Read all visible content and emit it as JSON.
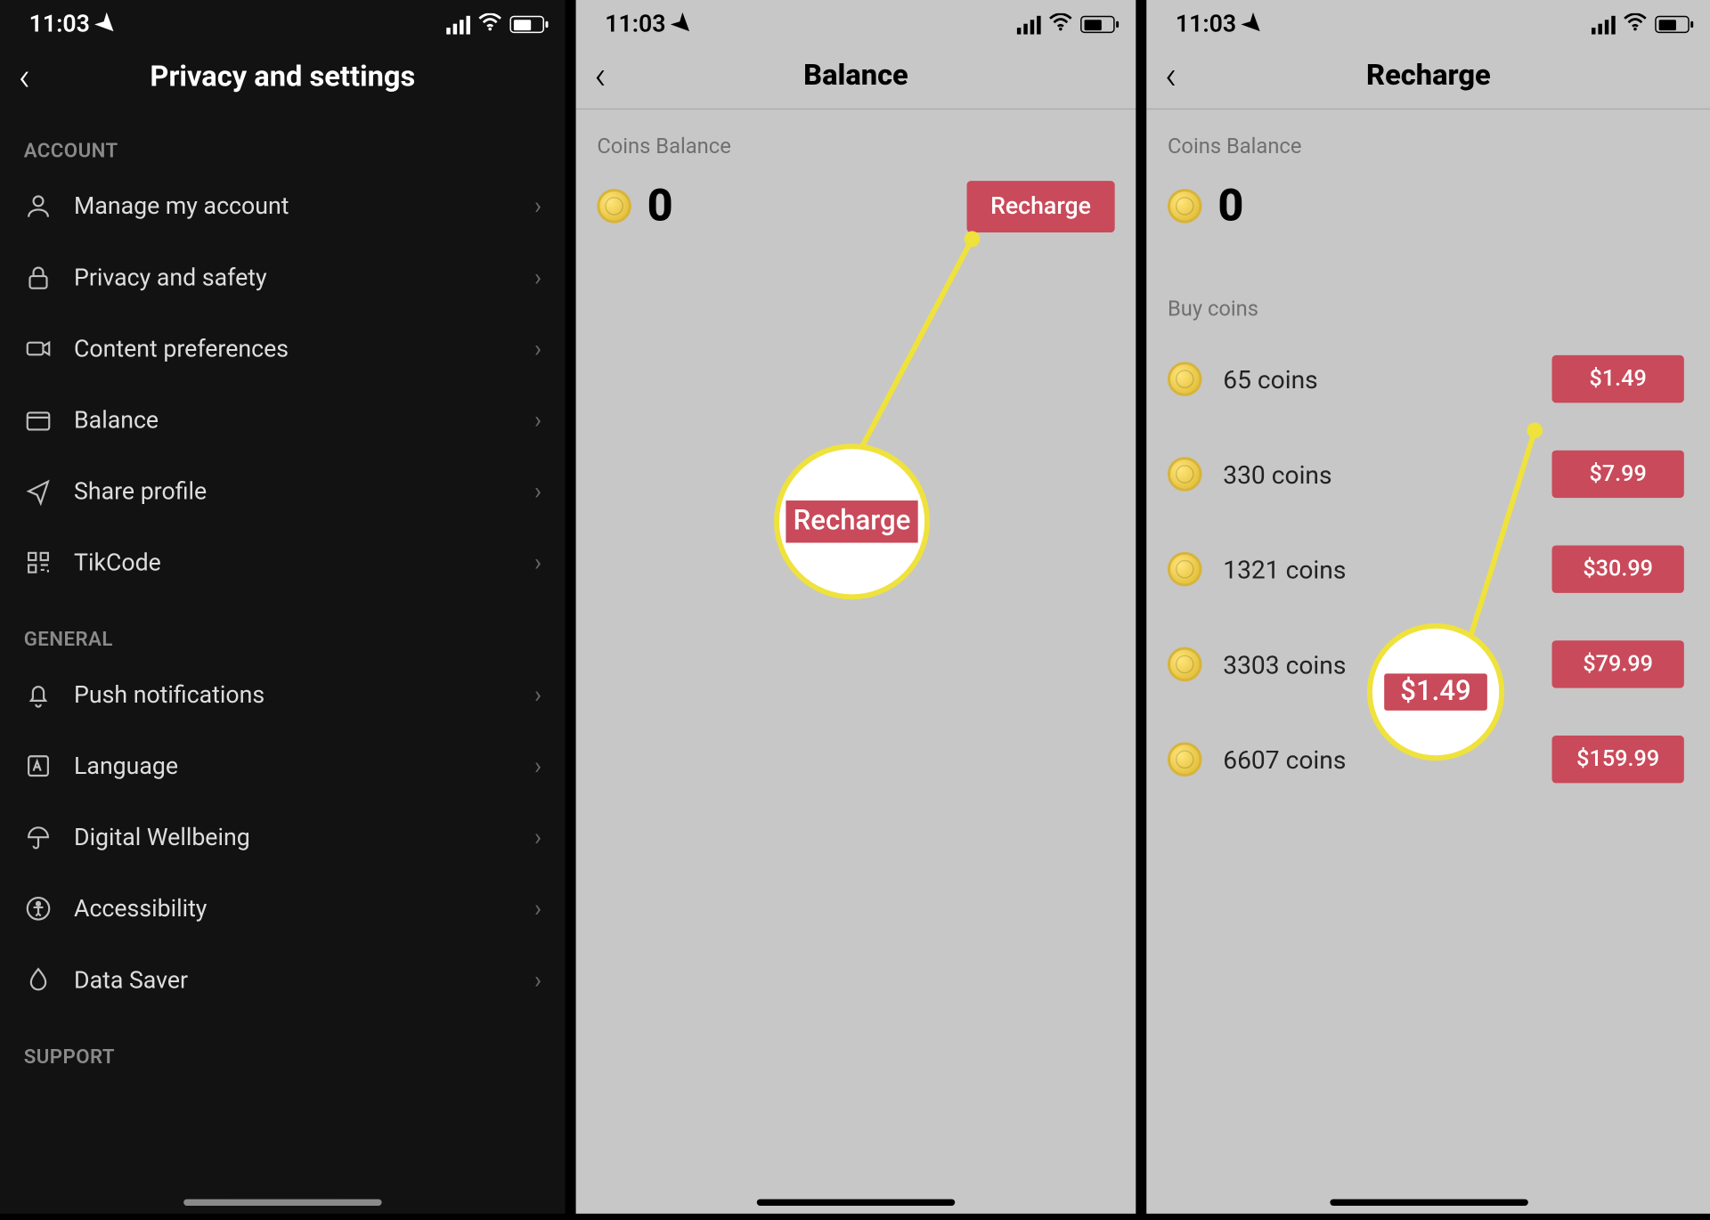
{
  "status": {
    "time": "11:03"
  },
  "screen1": {
    "title": "Privacy and settings",
    "sections": [
      {
        "header": "ACCOUNT",
        "items": [
          {
            "id": "manage-account",
            "icon": "person-icon",
            "label": "Manage my account"
          },
          {
            "id": "privacy-safety",
            "icon": "lock-icon",
            "label": "Privacy and safety"
          },
          {
            "id": "content-prefs",
            "icon": "video-icon",
            "label": "Content preferences"
          },
          {
            "id": "balance",
            "icon": "wallet-icon",
            "label": "Balance"
          },
          {
            "id": "share-profile",
            "icon": "share-icon",
            "label": "Share profile"
          },
          {
            "id": "tikcode",
            "icon": "qrcode-icon",
            "label": "TikCode"
          }
        ]
      },
      {
        "header": "GENERAL",
        "items": [
          {
            "id": "push-notifs",
            "icon": "bell-icon",
            "label": "Push notifications"
          },
          {
            "id": "language",
            "icon": "language-icon",
            "label": "Language"
          },
          {
            "id": "digital-well",
            "icon": "umbrella-icon",
            "label": "Digital Wellbeing"
          },
          {
            "id": "accessibility",
            "icon": "accessibility-icon",
            "label": "Accessibility"
          },
          {
            "id": "data-saver",
            "icon": "droplet-icon",
            "label": "Data Saver"
          }
        ]
      },
      {
        "header": "SUPPORT",
        "items": []
      }
    ]
  },
  "screen2": {
    "title": "Balance",
    "coins_label": "Coins Balance",
    "balance": "0",
    "recharge_label": "Recharge",
    "callout": "Recharge"
  },
  "screen3": {
    "title": "Recharge",
    "coins_label": "Coins Balance",
    "balance": "0",
    "buy_label": "Buy coins",
    "packages": [
      {
        "label": "65 coins",
        "price": "$1.49"
      },
      {
        "label": "330 coins",
        "price": "$7.99"
      },
      {
        "label": "1321 coins",
        "price": "$30.99"
      },
      {
        "label": "3303 coins",
        "price": "$79.99"
      },
      {
        "label": "6607 coins",
        "price": "$159.99"
      }
    ],
    "callout": "$1.49"
  },
  "colors": {
    "accent": "#c94a5a",
    "highlight": "#efe23c"
  }
}
